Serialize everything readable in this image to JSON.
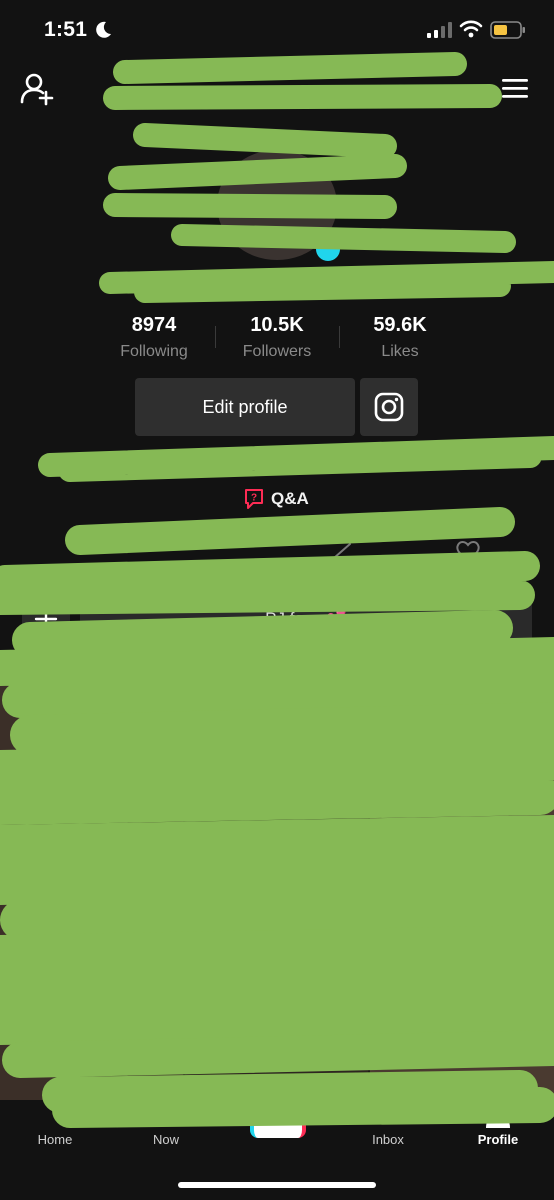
{
  "status_bar": {
    "time": "1:51",
    "icons": [
      "moon-icon",
      "signal-icon",
      "wifi-icon",
      "battery-icon"
    ],
    "battery_color": "#f5c342"
  },
  "top_nav": {
    "left_icon": "add-friend-icon",
    "right_icon": "menu-icon"
  },
  "stats": {
    "following": {
      "value": "8974",
      "label": "Following"
    },
    "followers": {
      "value": "10.5K",
      "label": "Followers"
    },
    "likes": {
      "value": "59.6K",
      "label": "Likes"
    }
  },
  "actions": {
    "edit_profile_label": "Edit profile",
    "instagram_icon": "instagram-icon"
  },
  "qa": {
    "label": "Q&A",
    "icon_color": "#fe2c55"
  },
  "playlist": {
    "add_icon": "plus-icon",
    "chip_label": "PJ favs 💕"
  },
  "bottom_nav": {
    "items": [
      {
        "label": "Home",
        "icon": "home-icon"
      },
      {
        "label": "Now",
        "icon": "now-icon"
      },
      {
        "label": "",
        "icon": "create-icon"
      },
      {
        "label": "Inbox",
        "icon": "inbox-icon"
      },
      {
        "label": "Profile",
        "icon": "profile-icon"
      }
    ]
  },
  "colors": {
    "background": "#121212",
    "button_bg": "#2f2f2f",
    "muted_text": "#8a8a8a",
    "redaction": "#86b955",
    "accent_cyan": "#20d5ec",
    "accent_red": "#fe2c55"
  }
}
